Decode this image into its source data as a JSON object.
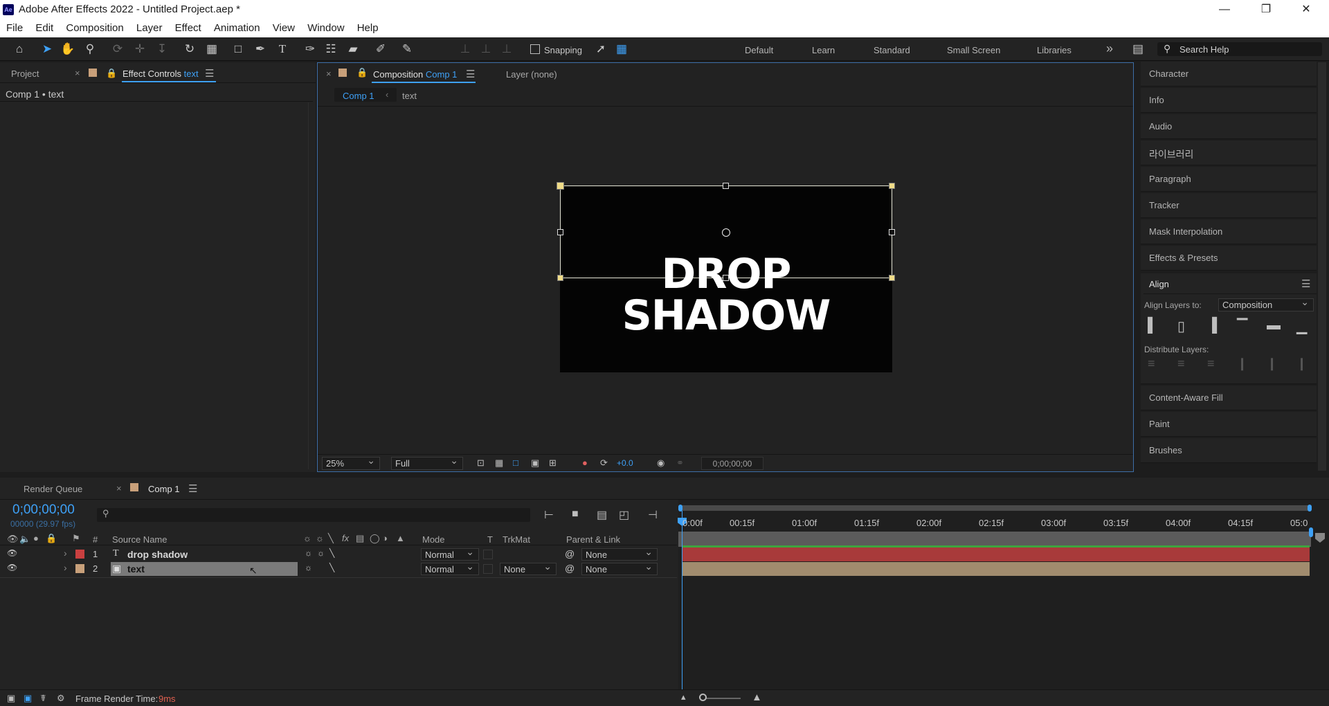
{
  "window": {
    "title": "Adobe After Effects 2022 - Untitled Project.aep *",
    "logo": "Ae",
    "minimize": "—",
    "restore": "❐",
    "close": "✕"
  },
  "menu": [
    "File",
    "Edit",
    "Composition",
    "Layer",
    "Effect",
    "Animation",
    "View",
    "Window",
    "Help"
  ],
  "toolbar": {
    "snapping": "Snapping",
    "workspaces": [
      "Default",
      "Learn",
      "Standard",
      "Small Screen",
      "Libraries"
    ],
    "overflow": "»",
    "search_placeholder": "Search Help"
  },
  "left_panel": {
    "tab_project": "Project",
    "tab_effect_controls": "Effect Controls",
    "effect_controls_target": "text",
    "breadcrumb": "Comp 1 • text"
  },
  "composition": {
    "tab_label": "Composition",
    "comp_name": "Comp 1",
    "layer_tab": "Layer (none)",
    "breadcrumb": [
      "Comp 1",
      "text"
    ],
    "canvas_text": "DROP SHADOW",
    "zoom": "25%",
    "resolution": "Full",
    "exposure": "+0.0",
    "timecode": "0;00;00;00"
  },
  "right_panel": {
    "items": [
      "Character",
      "Info",
      "Audio",
      "라이브러리",
      "Paragraph",
      "Tracker",
      "Mask Interpolation",
      "Effects & Presets"
    ],
    "align": {
      "title": "Align",
      "align_to_label": "Align Layers to:",
      "align_to_value": "Composition",
      "distribute_label": "Distribute Layers:"
    },
    "bottom_items": [
      "Content-Aware Fill",
      "Paint",
      "Brushes"
    ]
  },
  "timeline": {
    "tab_render_queue": "Render Queue",
    "tab_comp": "Comp 1",
    "timecode": "0;00;00;00",
    "frames": "00000 (29.97 fps)",
    "headers": {
      "num": "#",
      "source": "Source Name",
      "mode": "Mode",
      "t": "T",
      "trkmat": "TrkMat",
      "parent": "Parent & Link"
    },
    "layers": [
      {
        "num": "1",
        "type": "T",
        "name": "drop shadow",
        "color": "#c94040",
        "mode": "Normal",
        "trkmat": "",
        "parent": "None"
      },
      {
        "num": "2",
        "type": "▣",
        "name": "text",
        "color": "#c8a07a",
        "mode": "Normal",
        "trkmat": "None",
        "parent": "None"
      }
    ],
    "ruler": [
      "0:00f",
      "00:15f",
      "01:00f",
      "01:15f",
      "02:00f",
      "02:15f",
      "03:00f",
      "03:15f",
      "04:00f",
      "04:15f",
      "05:0"
    ]
  },
  "status": {
    "label": "Frame Render Time:",
    "value": "9ms"
  },
  "colors": {
    "accent": "#3ea1f7",
    "bar_layer1": "#a83a3a",
    "bar_layer2": "#a18c6e",
    "work_area": "#3fa33f"
  }
}
